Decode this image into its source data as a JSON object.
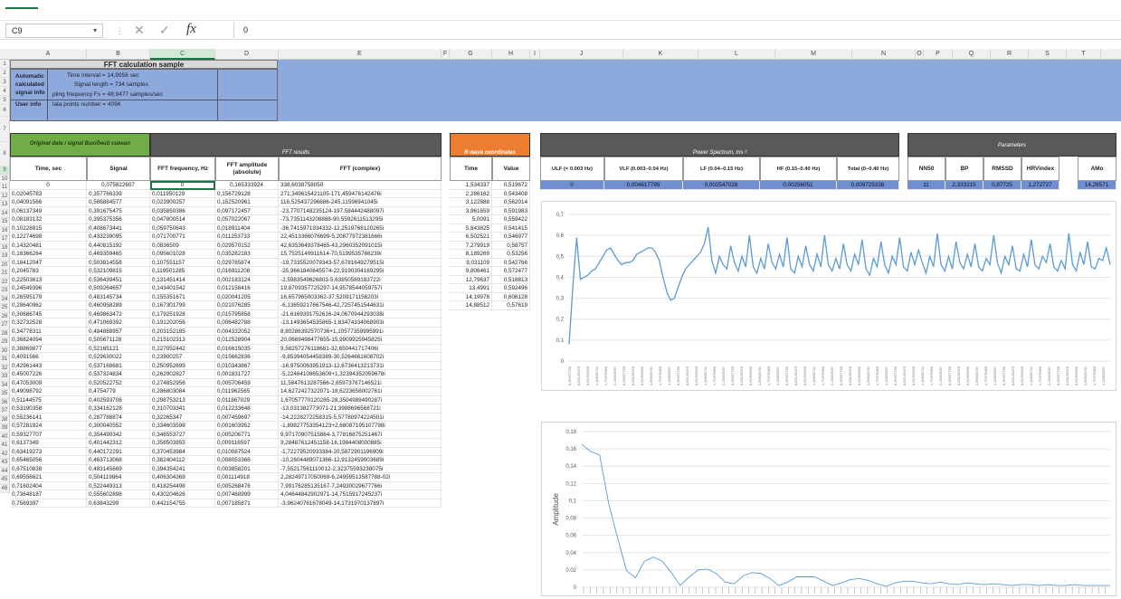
{
  "window": {
    "ribbon_accent": "#217346"
  },
  "formula_bar": {
    "name_box": "C9",
    "fx": "fx",
    "cancel": "✕",
    "enter": "✓",
    "value": "0"
  },
  "columns": [
    "A",
    "B",
    "C",
    "D",
    "E",
    "F",
    "G",
    "H",
    "I",
    "J",
    "K",
    "L",
    "M",
    "N",
    "O",
    "P",
    "Q",
    "R",
    "S",
    "T"
  ],
  "selected_column": "C",
  "selected_row": "9",
  "rows": [
    "1",
    "2",
    "3",
    "4",
    "5",
    "6",
    "7",
    "8",
    "9",
    "10",
    "11",
    "12",
    "13",
    "14",
    "15",
    "16",
    "17",
    "18",
    "19",
    "20",
    "21",
    "22",
    "23",
    "24",
    "25",
    "26",
    "27",
    "28",
    "29",
    "30",
    "31",
    "32",
    "33",
    "34",
    "35",
    "36",
    "37",
    "38",
    "39",
    "40",
    "41",
    "42",
    "43",
    "44",
    "45",
    "46"
  ],
  "sheet": {
    "title": "FFT calculation sample",
    "automatic_label": "Automatic calculated signal info",
    "time_interval": "Time interval = 14,9956 sec",
    "signal_length": "Signal length = 734 samples",
    "sampling": "pling frequency Fs = 48,9477 samples/sec",
    "user_info_label": "User info",
    "data_points": "lata points number = 4096",
    "original_header": "Original data / signal Вихідний сигнал",
    "fft_results": "FFT results",
    "rwave": "R-wave coordinates",
    "power_spectrum": "Power Spectrum, ms ²",
    "parameters": "Parameters",
    "col_time": "Time, sec",
    "col_signal": "Signal",
    "col_fftfreq": "FFT frequency, Hz",
    "col_fftamp": "FFT amplitude (absolute)",
    "col_fftcomplex": "FFT (complex)",
    "col_rtime": "Time",
    "col_rvalue": "Value",
    "ps_headers": [
      "ULF (< 0.003 Hz)",
      "VLF (0.003–0.04 Hz)",
      "LF (0.04–0.15 Hz)",
      "HF (0.15–0.40 Hz)",
      "Total (0–0.40 Hz)"
    ],
    "ps_values": [
      "0",
      "0,004617799",
      "0,002547028",
      "0,00256051",
      "0,009725338"
    ],
    "param_headers": [
      "NN50",
      "BP",
      "RMSSD",
      "HRVindex",
      "AMo"
    ],
    "param_values": [
      "11",
      "2,333215",
      "0,87725",
      "1,272727",
      "14,28571"
    ]
  },
  "table_rows": [
    [
      "0",
      "0,075822607",
      "0",
      "0,165333924",
      "338,6038758050"
    ],
    [
      "0,02045783",
      "0,357766339",
      "0,011950129",
      "0,156729128",
      "271,349615421105-171,459476142476i"
    ],
    [
      "0,04091566",
      "0,586884577",
      "0,023900257",
      "0,152520961",
      "116,525437296686-245,11596941045i"
    ],
    [
      "0,06137349",
      "0,391675475",
      "0,035850386",
      "0,097172457",
      "-23,7707148235124-197,584442488097i"
    ],
    [
      "0,08183132",
      "0,395375356",
      "0,047800514",
      "0,057022067",
      "-73,7351143208888-90,5592611513295i"
    ],
    [
      "0,10228915",
      "0,408673441",
      "0,059750643",
      "0,018911404",
      "-36,7415971934332-12,2519766120265i"
    ],
    [
      "0,12274698",
      "0,433239095",
      "0,071700771",
      "0,011253733",
      "22,4513366076699-5,20877972381666i"
    ],
    [
      "0,14320481",
      "0,440815192",
      "0,0836509",
      "0,029570152",
      "42,6353649378465-43,2960352091015i"
    ],
    [
      "0,16366264",
      "0,469359465",
      "0,095601028",
      "0,035282183",
      "15,7525149911614-70,5199535766239i"
    ],
    [
      "0,18412047",
      "0,503814558",
      "0,107551157",
      "0,029765874",
      "-19,7335520079343-57,6781649279515i"
    ],
    [
      "0,2045783",
      "0,532109815",
      "0,119501285",
      "0,016911208",
      "-25,9661840645574-22,9190304169295i"
    ],
    [
      "0,22503613",
      "0,536439451",
      "0,131451414",
      "0,002183124",
      "-2,5983549626803-5,63850589183722i"
    ],
    [
      "0,24549396",
      "0,509264657",
      "0,143401542",
      "0,012158416",
      "19,8709357725297-14,9578544059757i"
    ],
    [
      "0,26595179",
      "0,483145734",
      "0,155351671",
      "0,020041205",
      "16,657965003362-37,5209171156203i"
    ],
    [
      "0,28640962",
      "0,460958289",
      "0,167301799",
      "0,021076285",
      "-6,13659217667546-42,7257451544631i"
    ],
    [
      "0,30686745",
      "0,469863472",
      "0,179251928",
      "0,015795858",
      "-21,6169391752616-24,0670944293038i"
    ],
    [
      "0,32732528",
      "0,471069392",
      "0,191202056",
      "0,006482788",
      "-13,1493654535865-1,83474334068903i"
    ],
    [
      "0,34778311",
      "0,484888957",
      "0,203152185",
      "0,004332052",
      "8,80286392570736+1,10577359995991i"
    ],
    [
      "0,36824094",
      "0,505671128",
      "0,215102313",
      "0,012528904",
      "20,0669498477655-15,9909925945825i"
    ],
    [
      "0,38869877",
      "0,52165121",
      "0,227052442",
      "0,016615035",
      "9,58257276118681-32,650441717406i"
    ],
    [
      "0,4091566",
      "0,529630022",
      "0,23900257",
      "0,015662836",
      "-9,85394054458389-30,5264661608702i"
    ],
    [
      "0,42961443",
      "0,537168681",
      "0,250952699",
      "0,010343867",
      "-16,9750063951913-12,6736413213731i"
    ],
    [
      "0,45007226",
      "0,537324834",
      "0,262902827",
      "0,001831727",
      "-5,22464108653609+1,32394352059678i"
    ],
    [
      "0,47053009",
      "0,520522752",
      "0,274852956",
      "0,005706459",
      "11,5847613287566-2,65973767146521i"
    ],
    [
      "0,49098792",
      "0,4754779",
      "0,286803084",
      "0,011962565",
      "14,6272427322071-18,6223658002761i"
    ],
    [
      "0,51144575",
      "0,402593706",
      "0,298753213",
      "0,011867029",
      "1,67057770120285-28,3504989490287i"
    ],
    [
      "0,53190358",
      "0,334162128",
      "0,310703341",
      "0,012233648",
      "-13,031382773071-21,3988696568721i"
    ],
    [
      "0,55236141",
      "0,287788874",
      "0,32265347",
      "0,007459697",
      "-14,2228272258315-5,57780974224501i"
    ],
    [
      "0,57281924",
      "0,300040552",
      "0,334603598",
      "0,001603952",
      "-1,89827753354123+2,68087195107798i"
    ],
    [
      "0,59327707",
      "0,354490342",
      "0,346553727",
      "0,005206771",
      "9,97170907515864-3,77816875251467i"
    ],
    [
      "0,6137349",
      "0,401442312",
      "0,358503855",
      "0,009116597",
      "9,28487612451158-16,1984408000885i"
    ],
    [
      "0,63419273",
      "0,440172291",
      "0,370453984",
      "0,010087524",
      "-1,72279520933384-20,5872901196909i"
    ],
    [
      "0,65465056",
      "0,463713068",
      "0,382404112",
      "0,008053366",
      "-10,2604489071366-12,9132459003689i"
    ],
    [
      "0,67510838",
      "0,483145669",
      "0,394354241",
      "0,003858201",
      "-7,55217561110012-2,32375593238075i"
    ],
    [
      "0,69556621",
      "0,504119864",
      "0,406304369",
      "0,001114918",
      "2,28249717050069-6,24959513587788-02i"
    ],
    [
      "0,71602404",
      "0,522449313",
      "0,418254498",
      "0,005268476",
      "7,99176285135167-7,24930029677766i"
    ],
    [
      "0,73648187",
      "0,555602898",
      "0,430204626",
      "0,007468999",
      "4,04644842902971-14,7515917245237i"
    ],
    [
      "0,7569397",
      "0,63843299",
      "0,442154755",
      "0,007185871",
      "-3,96240761678049-14,1731970137897i"
    ]
  ],
  "rwave_rows": [
    [
      "1,534337",
      "0,519672"
    ],
    [
      "2,286162",
      "0,543408"
    ],
    [
      "3,122888",
      "0,562014"
    ],
    [
      "3,961659",
      "0,591983"
    ],
    [
      "5,0091",
      "0,559422"
    ],
    [
      "5,843825",
      "0,541415"
    ],
    [
      "6,502521",
      "0,546977"
    ],
    [
      "7,279919",
      "0,58757"
    ],
    [
      "8,189269",
      "0,53256"
    ],
    [
      "9,031109",
      "0,542766"
    ],
    [
      "9,806461",
      "0,572477"
    ],
    [
      "12,79637",
      "0,516813"
    ],
    [
      "13,4991",
      "0,592496"
    ],
    [
      "14,19978",
      "0,606128"
    ],
    [
      "14,88512",
      "0,57619"
    ]
  ],
  "chart_data": [
    {
      "type": "line",
      "ylim": [
        0,
        0.7
      ],
      "yticks": [
        "0,7",
        "0,6",
        "0,5",
        "0,4",
        "0,3",
        "0,2",
        "0,1",
        "0"
      ],
      "x_label_sample": [
        "0,16937736",
        "0,53135376",
        "0,91392536",
        "1,30635731",
        "1,72975099",
        "2,13053637"
      ],
      "grid": true,
      "values": [
        0.08,
        0.36,
        0.59,
        0.39,
        0.4,
        0.41,
        0.43,
        0.44,
        0.47,
        0.5,
        0.53,
        0.54,
        0.51,
        0.48,
        0.46,
        0.47,
        0.47,
        0.48,
        0.51,
        0.52,
        0.53,
        0.54,
        0.54,
        0.52,
        0.48,
        0.4,
        0.33,
        0.29,
        0.3,
        0.35,
        0.4,
        0.44,
        0.46,
        0.48,
        0.5,
        0.52,
        0.56,
        0.64,
        0.48,
        0.42,
        0.5,
        0.46,
        0.44,
        0.55,
        0.47,
        0.43,
        0.5,
        0.45,
        0.6,
        0.45,
        0.42,
        0.49,
        0.44,
        0.56,
        0.47,
        0.44,
        0.51,
        0.45,
        0.59,
        0.44,
        0.42,
        0.5,
        0.45,
        0.55,
        0.46,
        0.43,
        0.51,
        0.45,
        0.6,
        0.46,
        0.43,
        0.49,
        0.44,
        0.56,
        0.46,
        0.43,
        0.51,
        0.46,
        0.58,
        0.44,
        0.41,
        0.49,
        0.45,
        0.57,
        0.46,
        0.42,
        0.5,
        0.46,
        0.59,
        0.45,
        0.43,
        0.52,
        0.46,
        0.53,
        0.47,
        0.42,
        0.5,
        0.45,
        0.61,
        0.46,
        0.43,
        0.5,
        0.44,
        0.57,
        0.47,
        0.44,
        0.51,
        0.45,
        0.56,
        0.45,
        0.43,
        0.49,
        0.46,
        0.6,
        0.47,
        0.42,
        0.5,
        0.46,
        0.55,
        0.44,
        0.43,
        0.51,
        0.45,
        0.58,
        0.46,
        0.44,
        0.5,
        0.47,
        0.56,
        0.45,
        0.43,
        0.48,
        0.44,
        0.61,
        0.46,
        0.43,
        0.52,
        0.46,
        0.57,
        0.45,
        0.44,
        0.49,
        0.48,
        0.54,
        0.46
      ]
    },
    {
      "type": "line",
      "ylabel": "Amplitude",
      "ylim": [
        0,
        0.18
      ],
      "yticks": [
        "0,18",
        "0,16",
        "0,14",
        "0,12",
        "0,1",
        "0,08",
        "0,06",
        "0,04",
        "0,02",
        "0"
      ],
      "grid": true,
      "values": [
        0.165,
        0.157,
        0.153,
        0.097,
        0.057,
        0.019,
        0.011,
        0.03,
        0.035,
        0.03,
        0.017,
        0.002,
        0.012,
        0.02,
        0.021,
        0.016,
        0.006,
        0.004,
        0.013,
        0.017,
        0.016,
        0.01,
        0.002,
        0.006,
        0.012,
        0.012,
        0.012,
        0.007,
        0.002,
        0.005,
        0.009,
        0.01,
        0.008,
        0.004,
        0.001,
        0.005,
        0.007,
        0.007,
        0.005,
        0.004,
        0.006,
        0.004,
        0.003,
        0.005,
        0.004,
        0.003,
        0.004,
        0.003,
        0.002,
        0.003,
        0.003,
        0.002,
        0.003,
        0.002,
        0.002,
        0.003,
        0.002,
        0.002,
        0.002,
        0.002
      ]
    }
  ]
}
